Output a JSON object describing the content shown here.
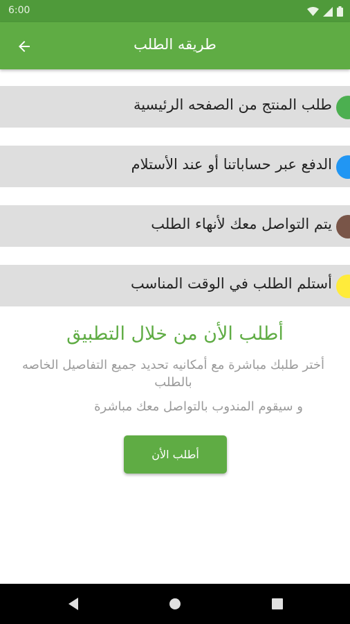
{
  "status_bar": {
    "time": "6:00"
  },
  "app_bar": {
    "title": "طريقه الطلب"
  },
  "steps": [
    {
      "label": "طلب المنتج  من  الصفحه الرئيسية",
      "color": "#4caf50"
    },
    {
      "label": "الدفع عبر حساباتنا أو عند الأستلام",
      "color": "#2196f3"
    },
    {
      "label": "يتم التواصل معك لأنهاء الطلب",
      "color": "#795548"
    },
    {
      "label": "أستلم الطلب في الوقت المناسب",
      "color": "#ffeb3b"
    }
  ],
  "promo": {
    "title": "أطلب الأن من خلال التطبيق",
    "description": "أختر طلبك مباشرة مع أمكانيه تحديد جميع التفاصيل الخاصه بالطلب",
    "note": "و سيقوم المندوب بالتواصل معك مباشرة",
    "button_label": "أطلب الأن"
  },
  "colors": {
    "accent": "#5fac44",
    "status_bar": "#4f9a3a",
    "step_bg": "#dedede"
  },
  "icons": [
    "back-arrow-icon",
    "wifi-icon",
    "signal-icon",
    "battery-icon",
    "nav-back-icon",
    "nav-home-icon",
    "nav-recents-icon"
  ]
}
